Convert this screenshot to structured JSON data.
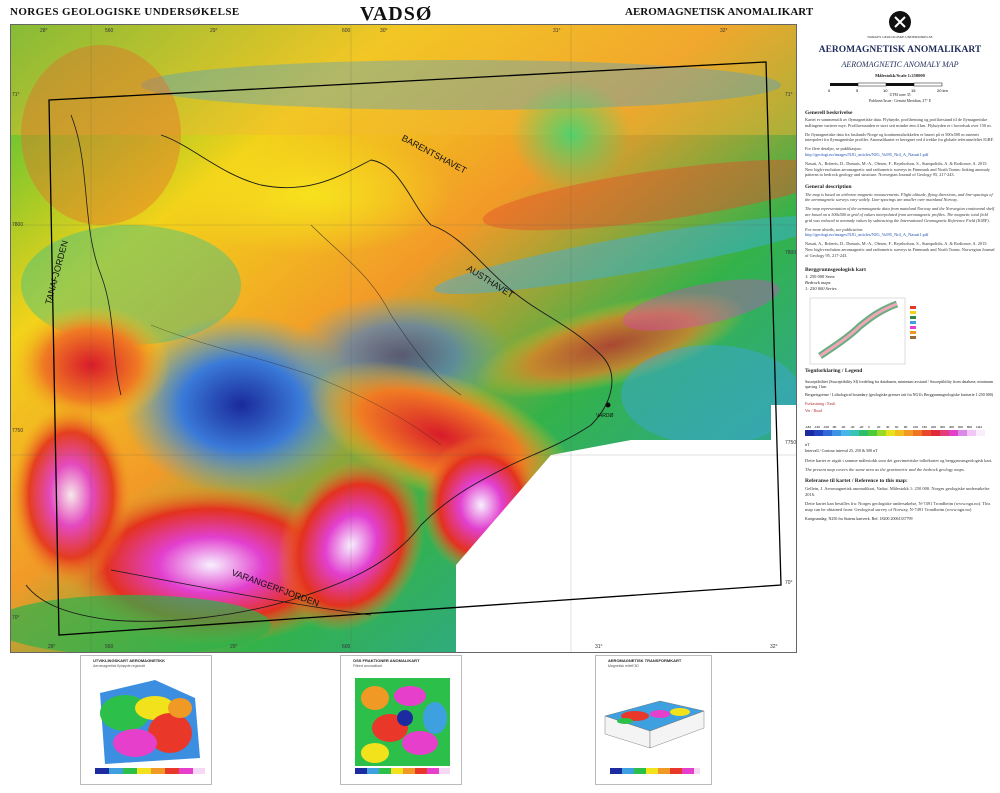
{
  "header": {
    "left": "NORGES GEOLOGISKE UNDERSØKELSE",
    "center": "VADSØ",
    "right": "AEROMAGNETISK ANOMALIKART"
  },
  "map": {
    "labels": {
      "barentshavet": "BARENTSHAVET",
      "austhavet": "AUSTHAVET",
      "tanafjorden": "TANAFJORDEN",
      "varangerfjorden": "VARANGERFJORDEN",
      "vardo": "VARDØ"
    },
    "ticks_top": [
      "28°",
      "560",
      "29°",
      "600",
      "30°",
      "31°",
      "32°"
    ],
    "ticks_bottom": [
      "28°",
      "560",
      "29°",
      "600",
      "31°",
      "32°"
    ],
    "ticks_left": [
      "71°",
      "7800",
      "7750",
      "70°"
    ],
    "ticks_right": [
      "71°",
      "7800",
      "7750",
      "70°"
    ]
  },
  "panel": {
    "logo_text": "NORGES GEOLOGISKE UNDERSØKELSE",
    "title": "AEROMAGNETISK ANOMALIKART",
    "subtitle": "AEROMAGNETIC ANOMALY MAP",
    "scale": "Målestokk/Scale 1:250000",
    "scale_ticks": [
      "0",
      "5",
      "10",
      "15",
      "20 km"
    ],
    "projection": "UTM sone 35",
    "publication": "Publisert/Issue : Gemini Meridian, 27° E",
    "sections": [
      {
        "title": "Generell beskrivelse",
        "text": "Kartet er sammenstilt av flymagnetiske data. Flyhøyde, profilretning og profilavstand til de flymagnetiske målingene varierer mye. Profilavstanden er stort sett mindre enn 4 km. Flyhøyden er i hovedsak over 150 m."
      },
      {
        "title": "",
        "text": "De flymagnetiske data fra fastlands-Norge og kontinentalsokkelen er basert på et 500x500 m rutenett interpolert fra flymagnetiske profiler. Anomalikartet er beregnet ved å trekke fra globale referansefeltet IGRF."
      },
      {
        "title": "",
        "text": "For flere detaljer, se publikasjon:"
      },
      {
        "title": "",
        "text": "Nasuti, A., Roberts, D., Dumais, M.-A., Olesen, F., Brynhofson, S., Stampolidis, A. & Rodionov, A. 2015: New high-resolution aeromagnetic and radiometric surveys in Finnmark and North Trøms: linking anomaly patterns to bedrock geology and structure. Norwegian Journal of Geology 95, 217-243."
      },
      {
        "title": "General description",
        "text": "The map is based on airborne magnetic measurements. Flight altitude, flying directions, and line-spacings of the aeromagnetic surveys vary widely. Line-spacings are smaller over mainland Norway."
      },
      {
        "title": "",
        "text": "The map representation of the aeromagnetic data from mainland Norway and the Norwegian continental shelf are based on a 500x500 m grid of values interpolated from aeromagnetic profiles. The magnetic total field grid was reduced to anomaly values by subtracting the International Geomagnetic Reference Field (IGRF)."
      },
      {
        "title": "",
        "text": "For more details, see publication:"
      },
      {
        "title": "",
        "text": "Nasuti, A., Roberts, D., Dumais, M.-A., Olesen, F., Brynhofson, S., Stampolidis, A. & Rodionov, A. 2015: New high-resolution aeromagnetic and radiometric surveys in Finnmark and North Trøms. Norwegian Journal of Geology 95, 217-243."
      }
    ],
    "link": "http://geologi.no/images/NJG_articles/NJG_Vol95_Nr4_A_Nasuti1.pdf",
    "bedrock": {
      "title": "Berggrunnsgeologisk kart",
      "line1": "1: 250 000 Serie",
      "line2": "Bedrock maps",
      "line3": "1: 250 000 Series"
    },
    "legend_title": "Tegnforklaring / Legend",
    "legend_items": [
      "Susceptibilitet (Susceptibility SI) fordeling fra databasen, minimum avstand / Susceptibility from database, minimum spacing 1 km",
      "Bergartsgrense / Lithological boundary (geologiske grenser tatt fra NGUs Berggrunnsgeologiske kartserie 1:250 000)",
      "Forkastning / Fault",
      "Vei / Road"
    ],
    "colorbar_ticks": [
      "-182",
      "-130",
      "-100",
      "-80",
      "-60",
      "-40",
      "-20",
      "0",
      "20",
      "40",
      "60",
      "80",
      "100",
      "150",
      "200",
      "300",
      "400",
      "600",
      "800",
      "1112"
    ],
    "colorbar_unit": "nT",
    "interval": "Intervall / Contour interval 25, 250 & 500 nT",
    "note1": "Dette kartet er utgitt i samme målestokk som det gravimetriske tolkekartet og berggrunnsgeologisk kart.",
    "note2": "The present map covers the same area as the gravimetric and the bedrock geology maps.",
    "ref_title": "Referanse til kartet / Reference to this map:",
    "ref_text": "Gellein, J. Aeromagnetisk anomalikart, Vadsø. Målestokk 1: 250 000. Norges geologiske undersøkelse 2016.",
    "order_text": "Dette kartet kan bestilles fra: Norges geologiske undersøkelse, N-7491 Trondheim (www.ngu.no). This map can be obtained from: Geological survey of Norway, N-7491 Trondheim (www.ngu.no)",
    "footer": "Kartgrunnlag: N250 fra Statens kartverk. Ref: 18200 20061337799"
  },
  "insets": [
    {
      "title": "UTVIKLINGSKART AEROMAGNETIKK",
      "sub": "Aeromagnetisk flyhøyde regionalt"
    },
    {
      "title": "OSS FRAKTIONER ANOMALIKART",
      "sub": "Filtrert anomalikart"
    },
    {
      "title": "AEROMAGNETISK TRANSFORMKART",
      "sub": "Magnetisk relieff 3D"
    }
  ],
  "colors": {
    "title_blue": "#1f2d5a",
    "map_border": "#000000"
  }
}
